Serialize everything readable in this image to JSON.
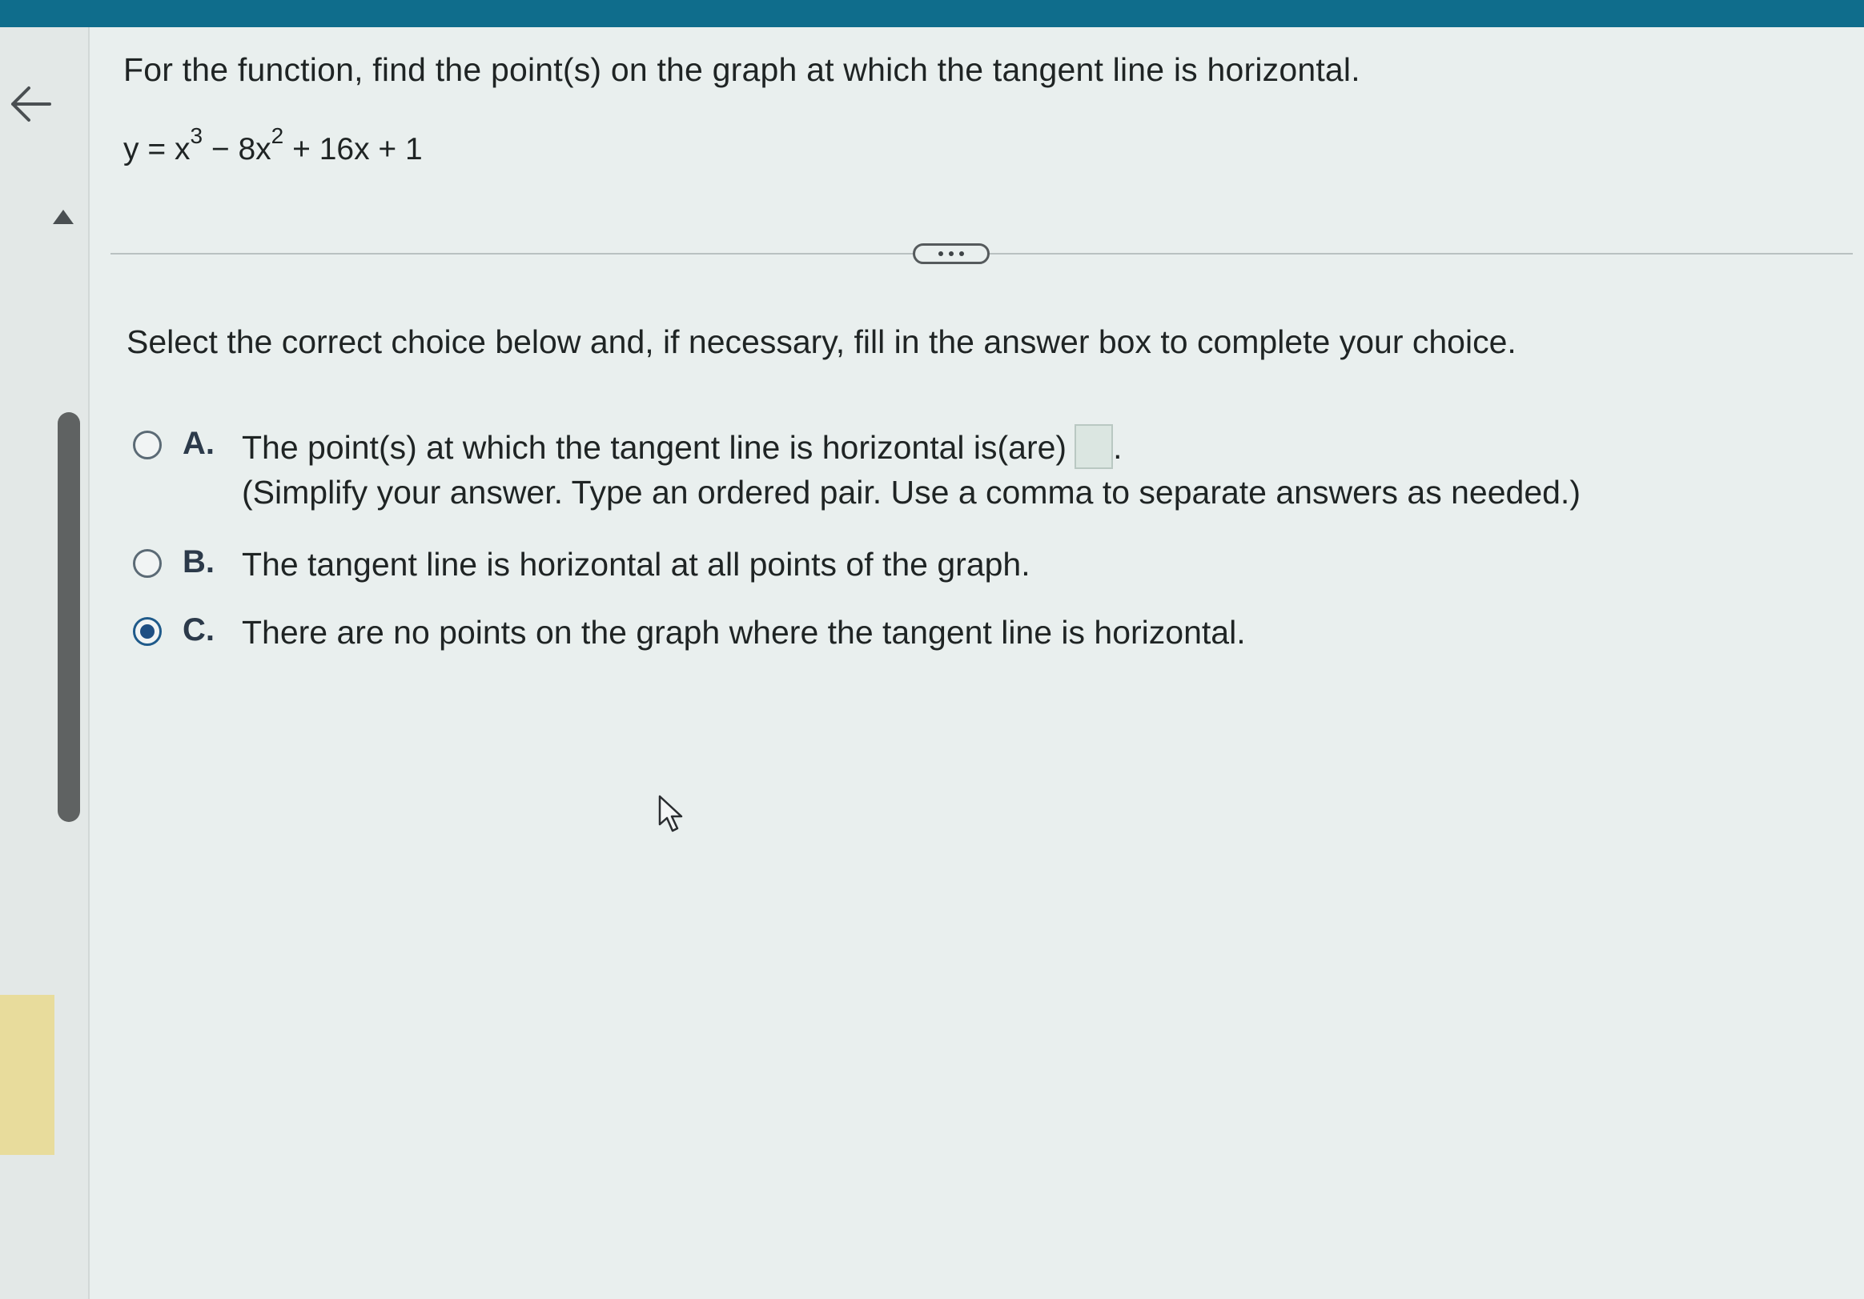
{
  "question": {
    "prompt": "For the function, find the point(s) on the graph at which the tangent line is horizontal.",
    "equation": {
      "lhs": "y = x",
      "exp1": "3",
      "mid": " − 8x",
      "exp2": "2",
      "tail": " + 16x + 1"
    }
  },
  "instruction": "Select the correct choice below and, if necessary, fill in the answer box to complete your choice.",
  "choices": [
    {
      "letter": "A.",
      "text": "The point(s) at which the tangent line is horizontal is(are)",
      "suffix": ".",
      "hint": "(Simplify your answer. Type an ordered pair. Use a comma to separate answers as needed.)",
      "selected": false
    },
    {
      "letter": "B.",
      "text": "The tangent line is horizontal at all points of the graph.",
      "selected": false
    },
    {
      "letter": "C.",
      "text": "There are no points on the graph where the tangent line is horizontal.",
      "selected": true
    }
  ],
  "answer_box": {
    "value": ""
  },
  "colors": {
    "top_bar": "#0f6d8c",
    "selected_radio": "#1f4f83",
    "highlight_tab": "#e8dc9c"
  },
  "icons": [
    "back-arrow-icon",
    "collapse-caret-icon",
    "more-options-icon",
    "mouse-cursor-icon"
  ]
}
